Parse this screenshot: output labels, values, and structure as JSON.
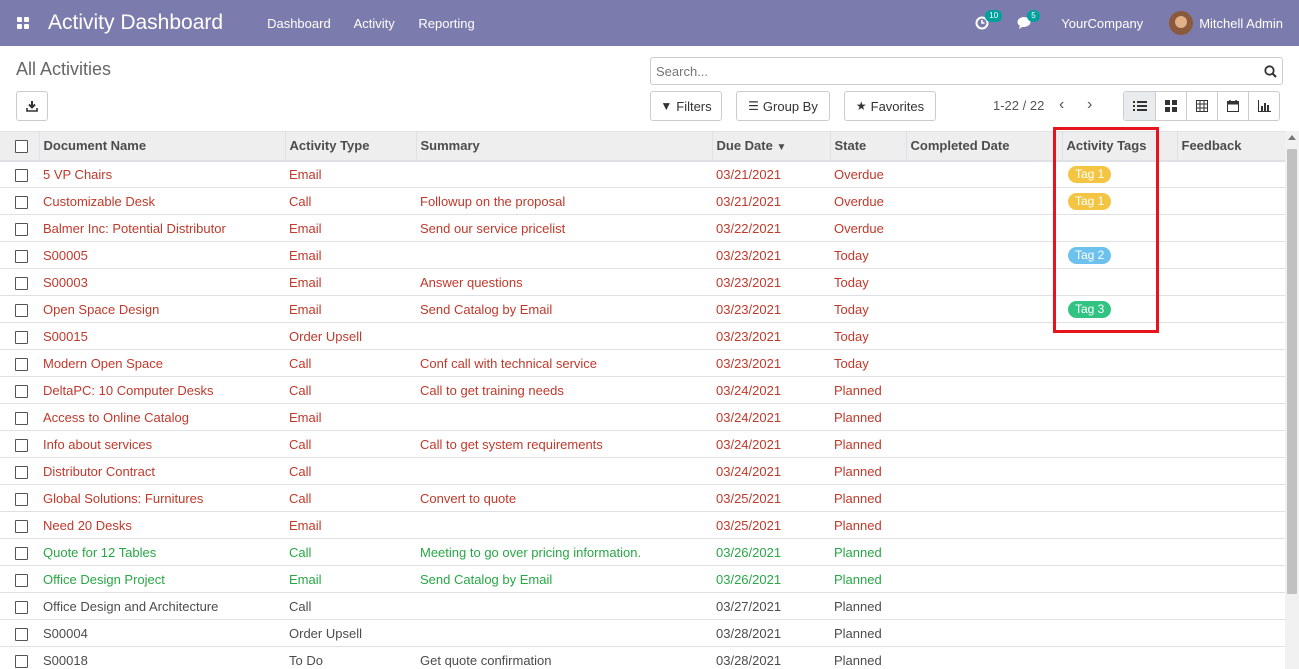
{
  "navbar": {
    "brand": "Activity Dashboard",
    "menu": [
      "Dashboard",
      "Activity",
      "Reporting"
    ],
    "activity_count": "10",
    "message_count": "5",
    "company": "YourCompany",
    "user": "Mitchell Admin",
    "color": "#7c7bad"
  },
  "control_panel": {
    "title": "All Activities",
    "search_placeholder": "Search...",
    "filters_label": "Filters",
    "groupby_label": "Group By",
    "favorites_label": "Favorites",
    "pager": "1-22 / 22"
  },
  "table": {
    "columns": [
      "Document Name",
      "Activity Type",
      "Summary",
      "Due Date",
      "State",
      "Completed Date",
      "Activity Tags",
      "Feedback"
    ],
    "rows": [
      {
        "name": "5 VP Chairs",
        "type": "Email",
        "summary": "",
        "due": "03/21/2021",
        "state": "Overdue",
        "completed": "",
        "tag": "Tag 1",
        "tag_color": "#f4c542",
        "style": "overdue"
      },
      {
        "name": "Customizable Desk",
        "type": "Call",
        "summary": "Followup on the proposal",
        "due": "03/21/2021",
        "state": "Overdue",
        "completed": "",
        "tag": "Tag 1",
        "tag_color": "#f4c542",
        "style": "overdue"
      },
      {
        "name": "Balmer Inc: Potential Distributor",
        "type": "Email",
        "summary": "Send our service pricelist",
        "due": "03/22/2021",
        "state": "Overdue",
        "completed": "",
        "tag": "",
        "tag_color": "",
        "style": "overdue"
      },
      {
        "name": "S00005",
        "type": "Email",
        "summary": "",
        "due": "03/23/2021",
        "state": "Today",
        "completed": "",
        "tag": "Tag 2",
        "tag_color": "#6cc1ed",
        "style": "today"
      },
      {
        "name": "S00003",
        "type": "Email",
        "summary": "Answer questions",
        "due": "03/23/2021",
        "state": "Today",
        "completed": "",
        "tag": "",
        "tag_color": "",
        "style": "today"
      },
      {
        "name": "Open Space Design",
        "type": "Email",
        "summary": "Send Catalog by Email",
        "due": "03/23/2021",
        "state": "Today",
        "completed": "",
        "tag": "Tag 3",
        "tag_color": "#30c381",
        "style": "today"
      },
      {
        "name": "S00015",
        "type": "Order Upsell",
        "summary": "",
        "due": "03/23/2021",
        "state": "Today",
        "completed": "",
        "tag": "",
        "tag_color": "",
        "style": "today"
      },
      {
        "name": "Modern Open Space",
        "type": "Call",
        "summary": "Conf call with technical service",
        "due": "03/23/2021",
        "state": "Today",
        "completed": "",
        "tag": "",
        "tag_color": "",
        "style": "today"
      },
      {
        "name": "DeltaPC: 10 Computer Desks",
        "type": "Call",
        "summary": "Call to get training needs",
        "due": "03/24/2021",
        "state": "Planned",
        "completed": "",
        "tag": "",
        "tag_color": "",
        "style": "planned"
      },
      {
        "name": "Access to Online Catalog",
        "type": "Email",
        "summary": "",
        "due": "03/24/2021",
        "state": "Planned",
        "completed": "",
        "tag": "",
        "tag_color": "",
        "style": "planned"
      },
      {
        "name": "Info about services",
        "type": "Call",
        "summary": "Call to get system requirements",
        "due": "03/24/2021",
        "state": "Planned",
        "completed": "",
        "tag": "",
        "tag_color": "",
        "style": "planned"
      },
      {
        "name": "Distributor Contract",
        "type": "Call",
        "summary": "",
        "due": "03/24/2021",
        "state": "Planned",
        "completed": "",
        "tag": "",
        "tag_color": "",
        "style": "planned"
      },
      {
        "name": "Global Solutions: Furnitures",
        "type": "Call",
        "summary": "Convert to quote",
        "due": "03/25/2021",
        "state": "Planned",
        "completed": "",
        "tag": "",
        "tag_color": "",
        "style": "planned"
      },
      {
        "name": "Need 20 Desks",
        "type": "Email",
        "summary": "",
        "due": "03/25/2021",
        "state": "Planned",
        "completed": "",
        "tag": "",
        "tag_color": "",
        "style": "planned"
      },
      {
        "name": "Quote for 12 Tables",
        "type": "Call",
        "summary": "Meeting to go over pricing information.",
        "due": "03/26/2021",
        "state": "Planned",
        "completed": "",
        "tag": "",
        "tag_color": "",
        "style": "future-green"
      },
      {
        "name": "Office Design Project",
        "type": "Email",
        "summary": "Send Catalog by Email",
        "due": "03/26/2021",
        "state": "Planned",
        "completed": "",
        "tag": "",
        "tag_color": "",
        "style": "future-green"
      },
      {
        "name": "Office Design and Architecture",
        "type": "Call",
        "summary": "",
        "due": "03/27/2021",
        "state": "Planned",
        "completed": "",
        "tag": "",
        "tag_color": "",
        "style": "normal"
      },
      {
        "name": "S00004",
        "type": "Order Upsell",
        "summary": "",
        "due": "03/28/2021",
        "state": "Planned",
        "completed": "",
        "tag": "",
        "tag_color": "",
        "style": "normal"
      },
      {
        "name": "S00018",
        "type": "To Do",
        "summary": "Get quote confirmation",
        "due": "03/28/2021",
        "state": "Planned",
        "completed": "",
        "tag": "",
        "tag_color": "",
        "style": "normal"
      }
    ]
  }
}
